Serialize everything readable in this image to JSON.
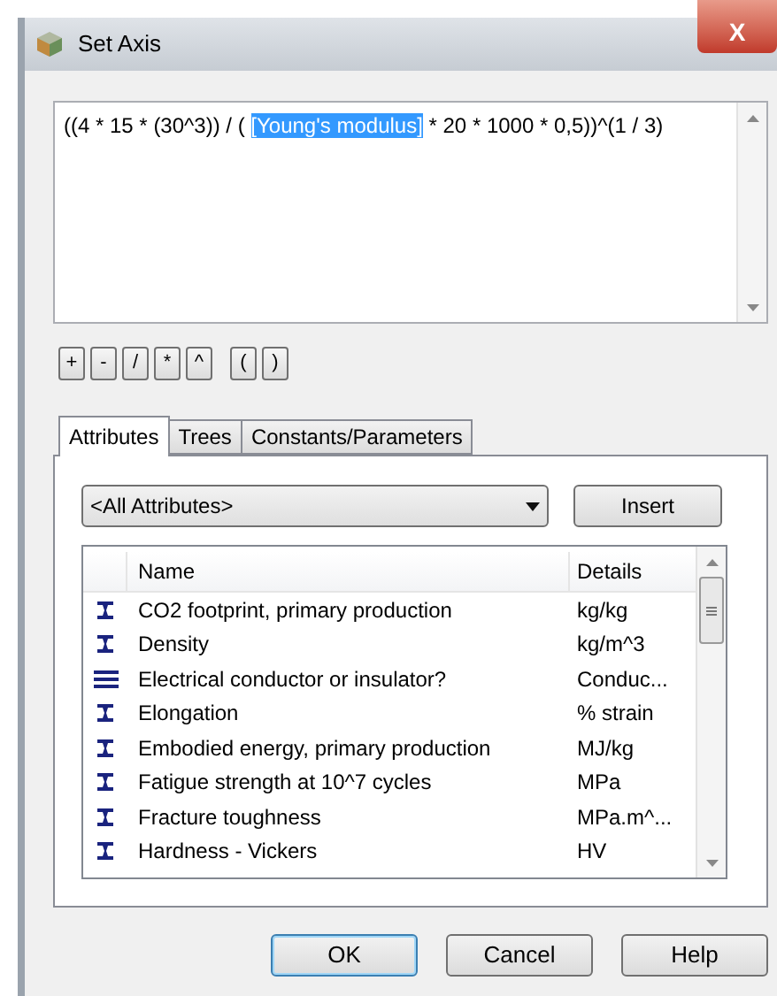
{
  "window": {
    "title": "Set Axis",
    "close": "X"
  },
  "expression": {
    "before": "((4 * 15 * (30^3)) / ( ",
    "selected": "[Young's modulus]",
    "after": " * 20 * 1000 * 0,5))^(1 / 3)"
  },
  "operators": [
    [
      "+",
      "-",
      "/",
      "*",
      "^"
    ],
    [
      "(",
      ")"
    ]
  ],
  "tabs": [
    {
      "label": "Attributes",
      "selected": true
    },
    {
      "label": "Trees",
      "selected": false
    },
    {
      "label": "Constants/Parameters",
      "selected": false
    }
  ],
  "filter": {
    "value": "<All Attributes>"
  },
  "insert_button": "Insert",
  "table": {
    "columns": [
      "Name",
      "Details"
    ],
    "rows": [
      {
        "kind": "numeric",
        "name": "CO2 footprint, primary production",
        "details": "kg/kg"
      },
      {
        "kind": "numeric",
        "name": "Density",
        "details": "kg/m^3"
      },
      {
        "kind": "discrete",
        "name": "Electrical conductor or insulator?",
        "details": "Conduc..."
      },
      {
        "kind": "numeric",
        "name": "Elongation",
        "details": "% strain"
      },
      {
        "kind": "numeric",
        "name": "Embodied energy, primary production",
        "details": "MJ/kg"
      },
      {
        "kind": "numeric",
        "name": "Fatigue strength at 10^7 cycles",
        "details": "MPa"
      },
      {
        "kind": "numeric",
        "name": "Fracture toughness",
        "details": "MPa.m^..."
      },
      {
        "kind": "numeric",
        "name": "Hardness - Vickers",
        "details": "HV"
      }
    ]
  },
  "buttons": [
    {
      "label": "OK",
      "default": true
    },
    {
      "label": "Cancel",
      "default": false
    },
    {
      "label": "Help",
      "default": false
    }
  ]
}
